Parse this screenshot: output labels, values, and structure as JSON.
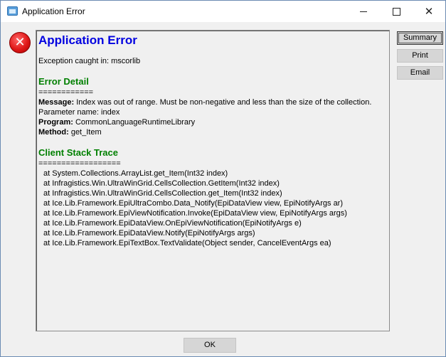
{
  "window": {
    "title": "Application Error",
    "minimize_glyph": "",
    "close_glyph": "✕"
  },
  "icon": {
    "name": "error-icon",
    "glyph": "✕",
    "color": "#e01818"
  },
  "report": {
    "title": "Application Error",
    "exception": "Exception caught in: mscorlib",
    "error_detail": {
      "heading": "Error Detail",
      "rule": "============",
      "message_label": "Message:",
      "message_value": " Index was out of range. Must be non-negative and less than the size of the collection.",
      "param_line": "Parameter name: index",
      "program_label": "Program:",
      "program_value": " CommonLanguageRuntimeLibrary",
      "method_label": "Method:",
      "method_value": " get_Item"
    },
    "stack": {
      "heading": "Client Stack Trace",
      "rule": "==================",
      "frames": [
        "at System.Collections.ArrayList.get_Item(Int32 index)",
        "at Infragistics.Win.UltraWinGrid.CellsCollection.GetItem(Int32 index)",
        "at Infragistics.Win.UltraWinGrid.CellsCollection.get_Item(Int32 index)",
        "at Ice.Lib.Framework.EpiUltraCombo.Data_Notify(EpiDataView view, EpiNotifyArgs ar)",
        "at Ice.Lib.Framework.EpiViewNotification.Invoke(EpiDataView view, EpiNotifyArgs args)",
        "at Ice.Lib.Framework.EpiDataView.OnEpiViewNotification(EpiNotifyArgs e)",
        "at Ice.Lib.Framework.EpiDataView.Notify(EpiNotifyArgs args)",
        "at Ice.Lib.Framework.EpiTextBox.TextValidate(Object sender, CancelEventArgs ea)"
      ]
    }
  },
  "buttons": {
    "summary": "Summary",
    "print": "Print",
    "email": "Email",
    "ok": "OK"
  }
}
